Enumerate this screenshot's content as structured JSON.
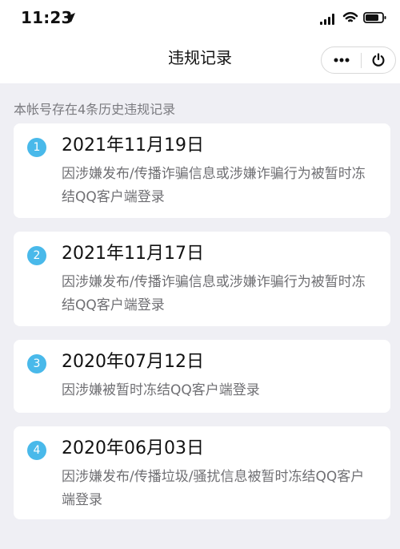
{
  "status": {
    "time": "11:23",
    "location_icon": "location-arrow-icon",
    "signal_icon": "signal-icon",
    "wifi_icon": "wifi-icon",
    "battery_icon": "battery-icon"
  },
  "nav": {
    "title": "违规记录",
    "more_icon": "more-icon",
    "close_icon": "power-icon"
  },
  "summary": "本帐号存在4条历史违规记录",
  "records": [
    {
      "number": "1",
      "date": "2021年11月19日",
      "description": "因涉嫌发布/传播诈骗信息或涉嫌诈骗行为被暂时冻结QQ客户端登录"
    },
    {
      "number": "2",
      "date": "2021年11月17日",
      "description": "因涉嫌发布/传播诈骗信息或涉嫌诈骗行为被暂时冻结QQ客户端登录"
    },
    {
      "number": "3",
      "date": "2020年07月12日",
      "description": "因涉嫌被暂时冻结QQ客户端登录"
    },
    {
      "number": "4",
      "date": "2020年06月03日",
      "description": "因涉嫌发布/传播垃圾/骚扰信息被暂时冻结QQ客户端登录"
    }
  ],
  "colors": {
    "background": "#efeff4",
    "card": "#ffffff",
    "badge": "#49b9ea",
    "secondary_text": "#6f6f73"
  }
}
